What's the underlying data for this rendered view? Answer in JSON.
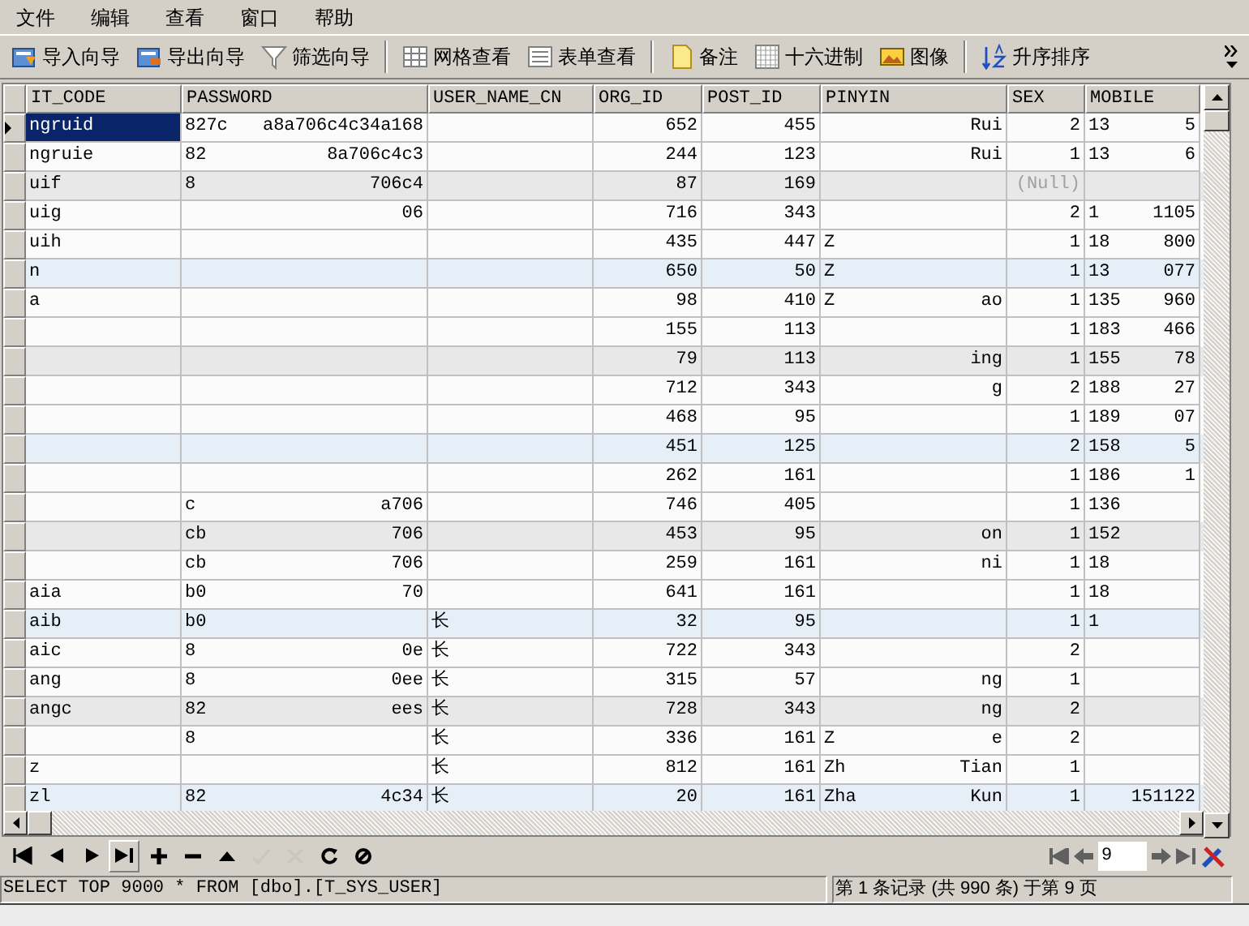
{
  "menu": [
    "文件",
    "编辑",
    "查看",
    "窗口",
    "帮助"
  ],
  "toolbar": [
    {
      "kind": "import",
      "label": "导入向导"
    },
    {
      "kind": "export",
      "label": "导出向导"
    },
    {
      "kind": "filter",
      "label": "筛选向导"
    },
    {
      "kind": "grid",
      "label": "网格查看"
    },
    {
      "kind": "form",
      "label": "表单查看"
    },
    {
      "kind": "note",
      "label": "备注"
    },
    {
      "kind": "hex",
      "label": "十六进制"
    },
    {
      "kind": "image",
      "label": "图像"
    },
    {
      "kind": "sort",
      "label": "升序排序"
    }
  ],
  "columns": [
    "IT_CODE",
    "PASSWORD",
    "USER_NAME_CN",
    "ORG_ID",
    "POST_ID",
    "PINYIN",
    "SEX",
    "MOBILE"
  ],
  "rows": [
    {
      "selected": true,
      "sex_null": false,
      "cells": [
        {
          "start": "ngruid"
        },
        {
          "start": "827c",
          "end": "a8a706c4c34a168"
        },
        {},
        {
          "end": "652"
        },
        {
          "end": "455"
        },
        {
          "end": "Rui"
        },
        {
          "end": "2"
        },
        {
          "start": "13",
          "end": "5"
        }
      ]
    },
    {
      "selected": false,
      "sex_null": false,
      "cells": [
        {
          "start": "ngruie"
        },
        {
          "start": "82",
          "end": "8a706c4c3"
        },
        {},
        {
          "end": "244"
        },
        {
          "end": "123"
        },
        {
          "end": "Rui"
        },
        {
          "end": "1"
        },
        {
          "start": "13",
          "end": "6"
        }
      ]
    },
    {
      "selected": false,
      "sex_null": true,
      "cells": [
        {
          "start": "uif"
        },
        {
          "start": "8",
          "end": "706c4"
        },
        {},
        {
          "end": "87"
        },
        {
          "end": "169"
        },
        {},
        {
          "end": "(Null)"
        },
        {}
      ]
    },
    {
      "selected": false,
      "sex_null": false,
      "cells": [
        {
          "start": "uig"
        },
        {
          "end": "06"
        },
        {},
        {
          "end": "716"
        },
        {
          "end": "343"
        },
        {},
        {
          "end": "2"
        },
        {
          "start": "1",
          "end": "1105"
        }
      ]
    },
    {
      "selected": false,
      "sex_null": false,
      "cells": [
        {
          "start": "uih"
        },
        {},
        {},
        {
          "end": "435"
        },
        {
          "end": "447"
        },
        {
          "start": "Z"
        },
        {
          "end": "1"
        },
        {
          "start": "18",
          "end": "800"
        }
      ]
    },
    {
      "selected": false,
      "sex_null": false,
      "cells": [
        {
          "start": "n"
        },
        {},
        {},
        {
          "end": "650"
        },
        {
          "end": "50"
        },
        {
          "start": "Z"
        },
        {
          "end": "1"
        },
        {
          "start": "13",
          "end": "077"
        }
      ]
    },
    {
      "selected": false,
      "sex_null": false,
      "cells": [
        {
          "start": "a"
        },
        {},
        {},
        {
          "end": "98"
        },
        {
          "end": "410"
        },
        {
          "start": "Z",
          "end": "ao"
        },
        {
          "end": "1"
        },
        {
          "start": "135",
          "end": "960"
        }
      ]
    },
    {
      "selected": false,
      "sex_null": false,
      "cells": [
        {},
        {},
        {},
        {
          "end": "155"
        },
        {
          "end": "113"
        },
        {},
        {
          "end": "1"
        },
        {
          "start": "183",
          "end": "466"
        }
      ]
    },
    {
      "selected": false,
      "sex_null": false,
      "cells": [
        {},
        {},
        {},
        {
          "end": "79"
        },
        {
          "end": "113"
        },
        {
          "end": "ing"
        },
        {
          "end": "1"
        },
        {
          "start": "155",
          "end": "78"
        }
      ]
    },
    {
      "selected": false,
      "sex_null": false,
      "cells": [
        {},
        {},
        {},
        {
          "end": "712"
        },
        {
          "end": "343"
        },
        {
          "end": "g"
        },
        {
          "end": "2"
        },
        {
          "start": "188",
          "end": "27"
        }
      ]
    },
    {
      "selected": false,
      "sex_null": false,
      "cells": [
        {},
        {},
        {},
        {
          "end": "468"
        },
        {
          "end": "95"
        },
        {},
        {
          "end": "1"
        },
        {
          "start": "189",
          "end": "07"
        }
      ]
    },
    {
      "selected": false,
      "sex_null": false,
      "cells": [
        {},
        {},
        {},
        {
          "end": "451"
        },
        {
          "end": "125"
        },
        {},
        {
          "end": "2"
        },
        {
          "start": "158",
          "end": "5"
        }
      ]
    },
    {
      "selected": false,
      "sex_null": false,
      "cells": [
        {},
        {},
        {},
        {
          "end": "262"
        },
        {
          "end": "161"
        },
        {},
        {
          "end": "1"
        },
        {
          "start": "186",
          "end": "1"
        }
      ]
    },
    {
      "selected": false,
      "sex_null": false,
      "cells": [
        {},
        {
          "start": "c",
          "end": "a706"
        },
        {},
        {
          "end": "746"
        },
        {
          "end": "405"
        },
        {},
        {
          "end": "1"
        },
        {
          "start": "136"
        }
      ]
    },
    {
      "selected": false,
      "sex_null": false,
      "cells": [
        {},
        {
          "start": "cb",
          "end": "706"
        },
        {},
        {
          "end": "453"
        },
        {
          "end": "95"
        },
        {
          "end": "on"
        },
        {
          "end": "1"
        },
        {
          "start": "152"
        }
      ]
    },
    {
      "selected": false,
      "sex_null": false,
      "cells": [
        {},
        {
          "start": "cb",
          "end": "706"
        },
        {},
        {
          "end": "259"
        },
        {
          "end": "161"
        },
        {
          "end": "ni"
        },
        {
          "end": "1"
        },
        {
          "start": "18"
        }
      ]
    },
    {
      "selected": false,
      "sex_null": false,
      "cells": [
        {
          "start": "aia"
        },
        {
          "start": "b0",
          "end": "70"
        },
        {},
        {
          "end": "641"
        },
        {
          "end": "161"
        },
        {},
        {
          "end": "1"
        },
        {
          "start": "18"
        }
      ]
    },
    {
      "selected": false,
      "sex_null": false,
      "cells": [
        {
          "start": "aib"
        },
        {
          "start": "b0"
        },
        {
          "start": "长"
        },
        {
          "end": "32"
        },
        {
          "end": "95"
        },
        {},
        {
          "end": "1"
        },
        {
          "start": "1"
        }
      ]
    },
    {
      "selected": false,
      "sex_null": false,
      "cells": [
        {
          "start": "aic"
        },
        {
          "start": "8",
          "end": "0e"
        },
        {
          "start": "长"
        },
        {
          "end": "722"
        },
        {
          "end": "343"
        },
        {},
        {
          "end": "2"
        },
        {}
      ]
    },
    {
      "selected": false,
      "sex_null": false,
      "cells": [
        {
          "start": "ang"
        },
        {
          "start": "8",
          "end": "0ee"
        },
        {
          "start": "长"
        },
        {
          "end": "315"
        },
        {
          "end": "57"
        },
        {
          "end": "ng"
        },
        {
          "end": "1"
        },
        {}
      ]
    },
    {
      "selected": false,
      "sex_null": false,
      "cells": [
        {
          "start": "angc"
        },
        {
          "start": "82",
          "end": "ees"
        },
        {
          "start": "长"
        },
        {
          "end": "728"
        },
        {
          "end": "343"
        },
        {
          "end": "ng"
        },
        {
          "end": "2"
        },
        {}
      ]
    },
    {
      "selected": false,
      "sex_null": false,
      "cells": [
        {},
        {
          "start": "8"
        },
        {
          "start": "长"
        },
        {
          "end": "336"
        },
        {
          "end": "161"
        },
        {
          "start": "Z",
          "end": "e"
        },
        {
          "end": "2"
        },
        {}
      ]
    },
    {
      "selected": false,
      "sex_null": false,
      "cells": [
        {
          "start": "z"
        },
        {},
        {
          "start": "长"
        },
        {
          "end": "812"
        },
        {
          "end": "161"
        },
        {
          "start": "Zh",
          "end": "Tian"
        },
        {
          "end": "1"
        },
        {}
      ]
    },
    {
      "selected": false,
      "sex_null": false,
      "cells": [
        {
          "start": "zl"
        },
        {
          "start": "82",
          "end": "4c34"
        },
        {
          "start": "长"
        },
        {
          "end": "20"
        },
        {
          "end": "161"
        },
        {
          "start": "Zha",
          "end": "Kun"
        },
        {
          "end": "1"
        },
        {
          "end": "151122"
        }
      ]
    }
  ],
  "nav_buttons": [
    {
      "kind": "first",
      "disabled": false,
      "pressed": false
    },
    {
      "kind": "prev",
      "disabled": false,
      "pressed": false
    },
    {
      "kind": "next",
      "disabled": false,
      "pressed": false
    },
    {
      "kind": "last",
      "disabled": false,
      "pressed": true
    },
    {
      "kind": "add",
      "disabled": false,
      "pressed": false
    },
    {
      "kind": "delete",
      "disabled": false,
      "pressed": false
    },
    {
      "kind": "up",
      "disabled": false,
      "pressed": false
    },
    {
      "kind": "apply",
      "disabled": true,
      "pressed": false
    },
    {
      "kind": "cancel",
      "disabled": true,
      "pressed": false
    },
    {
      "kind": "refresh",
      "disabled": false,
      "pressed": false
    },
    {
      "kind": "stop",
      "disabled": false,
      "pressed": false
    }
  ],
  "page_field": {
    "value": "9"
  },
  "status": {
    "query": "SELECT TOP 9000  * FROM [dbo].[T_SYS_USER]",
    "record": "第 1 条记录 (共 990 条) 于第 9 页"
  }
}
